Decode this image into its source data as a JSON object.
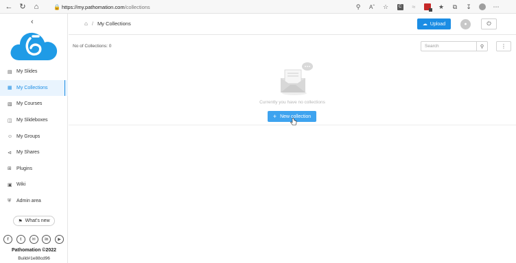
{
  "browser": {
    "url_host": "https://my.pathomation.com",
    "url_path": "/collections",
    "icons": [
      "back-icon",
      "refresh-icon",
      "home-icon",
      "lock-icon",
      "key-icon",
      "read-aloud-icon",
      "favorite-add-icon",
      "extension-c-icon",
      "extension-icon",
      "extension-red-icon",
      "favorites-icon",
      "collections-icon",
      "download-icon",
      "profile-icon",
      "more-icon"
    ]
  },
  "sidebar": {
    "items": [
      {
        "label": "My Slides",
        "icon": "slides-icon"
      },
      {
        "label": "My Collections",
        "icon": "collections-icon",
        "active": true
      },
      {
        "label": "My Courses",
        "icon": "courses-icon"
      },
      {
        "label": "My Slideboxes",
        "icon": "slideboxes-icon"
      },
      {
        "label": "My Groups",
        "icon": "groups-icon"
      },
      {
        "label": "My Shares",
        "icon": "shares-icon"
      },
      {
        "label": "Plugins",
        "icon": "plugins-icon"
      },
      {
        "label": "Wiki",
        "icon": "wiki-icon"
      },
      {
        "label": "Admin area",
        "icon": "admin-icon"
      }
    ],
    "whats_new": "What's new",
    "socials": [
      "facebook-icon",
      "twitter-icon",
      "email-icon",
      "linkedin-icon",
      "youtube-icon"
    ],
    "copyright": "Pathomation ©2022",
    "build": "Build#1e88cd96"
  },
  "header": {
    "breadcrumb": "My Collections",
    "upload": "Upload"
  },
  "main": {
    "count": "No of Collections: 0",
    "search_placeholder": "Search",
    "empty": "Currently you have no collections",
    "new_collection": "New collection"
  },
  "colors": {
    "accent": "#1b8de4",
    "new_button": "#3ea3ef",
    "logo": "#1f9be6"
  }
}
